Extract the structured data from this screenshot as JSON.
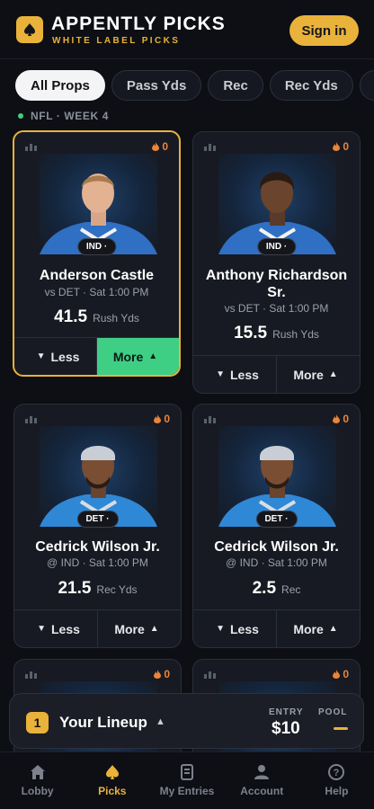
{
  "header": {
    "title": "APPENTLY PICKS",
    "subtitle": "WHITE LABEL PICKS",
    "signin_label": "Sign in",
    "logo_icon": "spade-icon",
    "brand_color": "#e9b23a"
  },
  "filters": {
    "chips": [
      "All Props",
      "Pass Yds",
      "Rec",
      "Rec Yds",
      "Ru"
    ],
    "active": "All Props"
  },
  "league_label": "NFL · WEEK 4",
  "cards": [
    {
      "team": "IND ·",
      "name": "Anderson Castle",
      "matchup": "vs DET · Sat 1:00 PM",
      "line": "41.5",
      "stat": "Rush Yds",
      "heat": "0",
      "less_label": "Less",
      "more_label": "More",
      "selected": "more"
    },
    {
      "team": "IND ·",
      "name": "Anthony Richardson Sr.",
      "matchup": "vs DET · Sat 1:00 PM",
      "line": "15.5",
      "stat": "Rush Yds",
      "heat": "0",
      "less_label": "Less",
      "more_label": "More",
      "selected": "none"
    },
    {
      "team": "DET ·",
      "name": "Cedrick Wilson Jr.",
      "matchup": "@ IND · Sat 1:00 PM",
      "line": "21.5",
      "stat": "Rec Yds",
      "heat": "0",
      "less_label": "Less",
      "more_label": "More",
      "selected": "none"
    },
    {
      "team": "DET ·",
      "name": "Cedrick Wilson Jr.",
      "matchup": "@ IND · Sat 1:00 PM",
      "line": "2.5",
      "stat": "Rec",
      "heat": "0",
      "less_label": "Less",
      "more_label": "More",
      "selected": "none"
    },
    {
      "heat": "0"
    },
    {
      "heat": "0"
    }
  ],
  "lineup": {
    "count": "1",
    "title": "Your Lineup",
    "entry_label": "ENTRY",
    "entry_value": "$10",
    "pool_label": "POOL"
  },
  "nav": {
    "items": [
      {
        "label": "Lobby",
        "icon": "home-icon"
      },
      {
        "label": "Picks",
        "icon": "spade-icon"
      },
      {
        "label": "My Entries",
        "icon": "document-icon"
      },
      {
        "label": "Account",
        "icon": "person-icon"
      },
      {
        "label": "Help",
        "icon": "help-icon"
      }
    ],
    "active": "Picks"
  }
}
